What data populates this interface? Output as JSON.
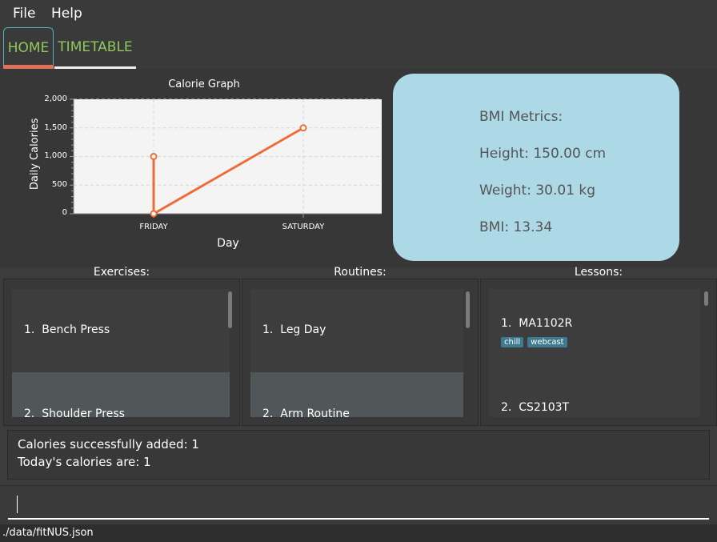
{
  "menu": {
    "file": "File",
    "help": "Help"
  },
  "tabs": [
    {
      "label": "HOME"
    },
    {
      "label": "TIMETABLE"
    }
  ],
  "chart_data": {
    "type": "line",
    "title": "Calorie Graph",
    "xlabel": "Day",
    "ylabel": "Daily Calories",
    "categories": [
      "FRIDAY",
      "SATURDAY"
    ],
    "points": [
      {
        "x": "FRIDAY",
        "y": 1000
      },
      {
        "x": "FRIDAY",
        "y": 0
      },
      {
        "x": "SATURDAY",
        "y": 1500
      }
    ],
    "yticks": [
      "0",
      "500",
      "1,000",
      "1,500",
      "2,000"
    ],
    "ylim": [
      0,
      2000
    ],
    "grid": true,
    "line_color": "#ef6c37"
  },
  "bmi": {
    "title": "BMI Metrics:",
    "height": "Height: 150.00 cm",
    "weight": "Weight: 30.01 kg",
    "bmi": "BMI: 13.34"
  },
  "exercises": {
    "header": "Exercises:",
    "items": [
      {
        "index": "1.",
        "name": "Bench Press"
      },
      {
        "index": "2.",
        "name": "Shoulder Press"
      }
    ]
  },
  "routines": {
    "header": "Routines:",
    "items": [
      {
        "index": "1.",
        "name": "Leg Day"
      },
      {
        "index": "2.",
        "name": "Arm Routine"
      }
    ]
  },
  "lessons": {
    "header": "Lessons:",
    "items": [
      {
        "index": "1.",
        "name": "MA1102R",
        "tags": [
          "chill",
          "webcast"
        ]
      },
      {
        "index": "2.",
        "name": "CS2103T",
        "tags": []
      }
    ]
  },
  "result": {
    "line1": "Calories successfully added: 1",
    "line2": "Today's calories are: 1"
  },
  "command": {
    "value": ""
  },
  "status": {
    "path": "./data/fitNUS.json"
  },
  "colors": {
    "accent": "#8fc85d",
    "bmi_card": "#add8e6",
    "tag": "#3e7b91",
    "tab_selected_underline": "#e26e5c"
  }
}
